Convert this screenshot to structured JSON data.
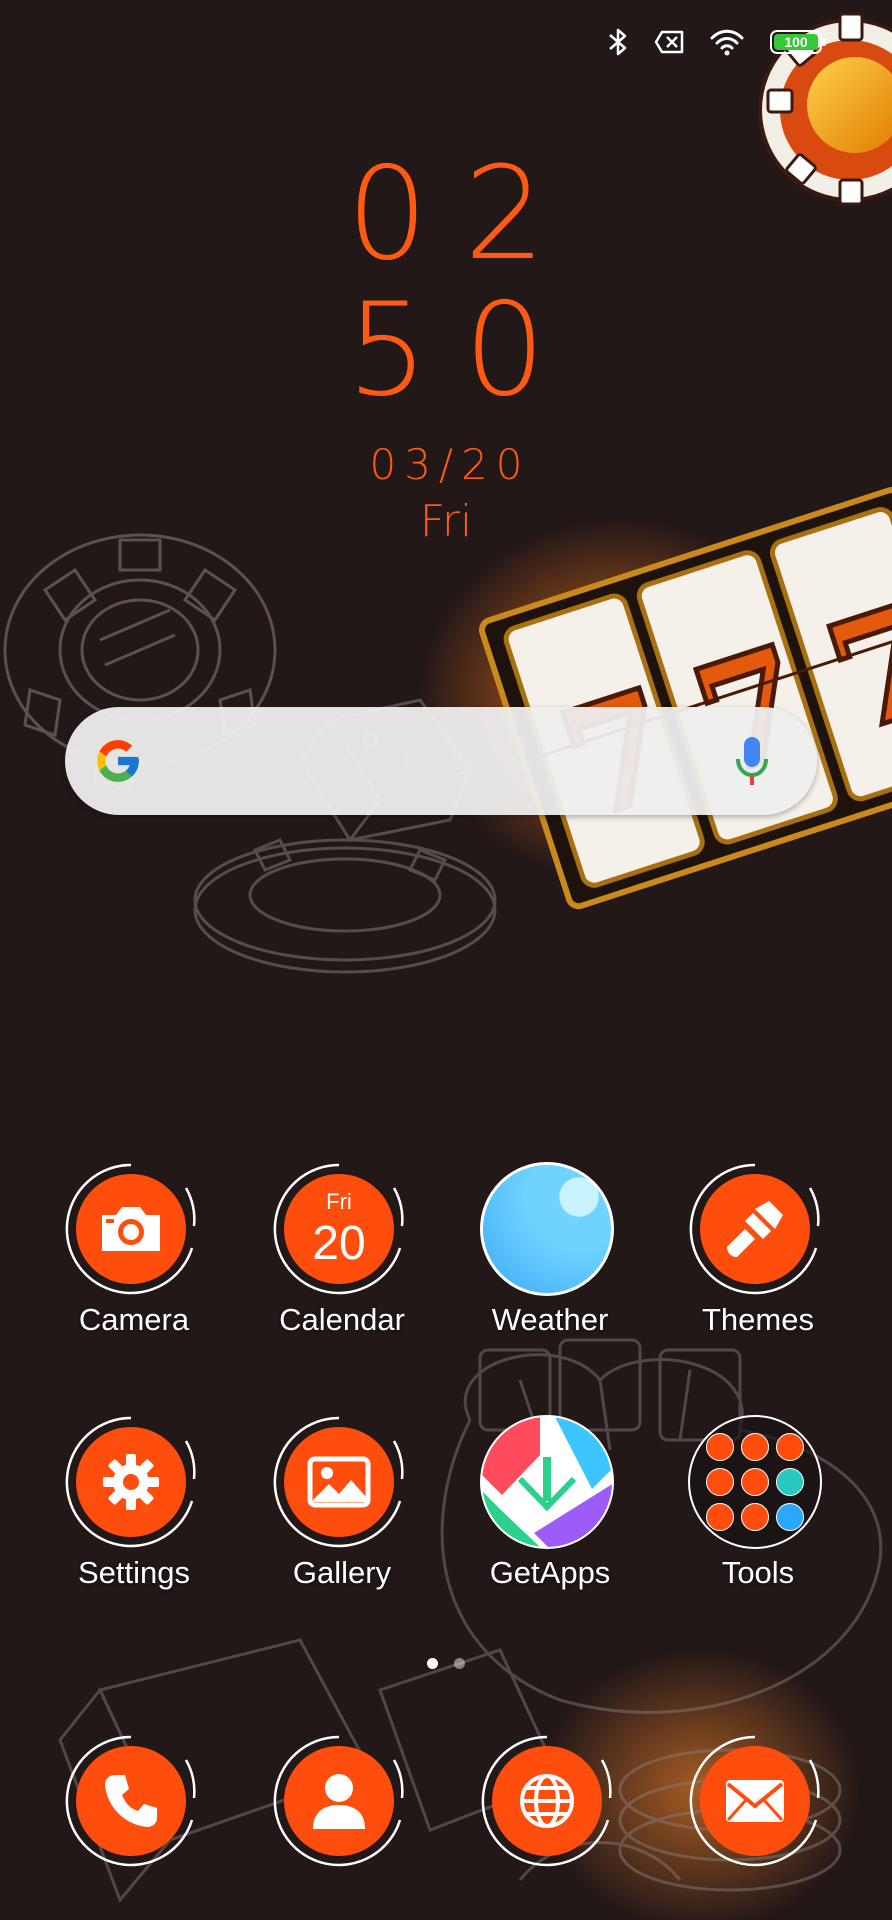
{
  "status_bar": {
    "icons": [
      "bluetooth-icon",
      "no-sim-icon",
      "wifi-icon",
      "battery-icon"
    ],
    "battery_level": "100"
  },
  "clock": {
    "hour": "02",
    "minute": "50",
    "date": "03/20",
    "day": "Fri"
  },
  "search_bar": {
    "left_icon": "google-logo",
    "right_icon": "microphone-icon"
  },
  "apps": [
    {
      "label": "Camera",
      "icon": "camera-icon"
    },
    {
      "label": "Calendar",
      "icon": "calendar-icon",
      "day": "Fri",
      "date": "20"
    },
    {
      "label": "Weather",
      "icon": "weather-icon"
    },
    {
      "label": "Themes",
      "icon": "paintbrush-icon"
    },
    {
      "label": "Settings",
      "icon": "gear-icon"
    },
    {
      "label": "Gallery",
      "icon": "picture-icon"
    },
    {
      "label": "GetApps",
      "icon": "getapps-icon"
    },
    {
      "label": "Tools",
      "icon": "tools-folder-icon"
    }
  ],
  "page_indicator": {
    "pages": 2,
    "current": 1
  },
  "dock": [
    {
      "icon": "phone-icon"
    },
    {
      "icon": "contacts-icon"
    },
    {
      "icon": "browser-icon"
    },
    {
      "icon": "messages-icon"
    }
  ],
  "colors": {
    "accent": "#ff4d0d",
    "clock": "#ff5a12",
    "background": "#231818",
    "battery": "#37c837"
  }
}
